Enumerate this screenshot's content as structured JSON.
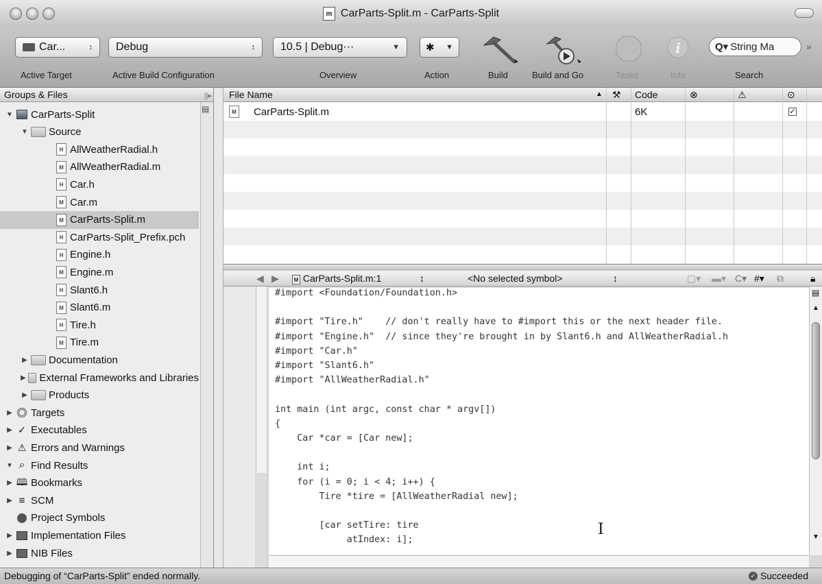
{
  "window": {
    "title": "CarParts-Split.m - CarParts-Split"
  },
  "toolbar": {
    "target_value": "Car...",
    "config_value": "Debug",
    "overview_value": "10.5 | Debug···",
    "search_placeholder": "String Ma",
    "labels": {
      "active_target": "Active Target",
      "active_build_configuration": "Active Build Configuration",
      "overview": "Overview",
      "action": "Action",
      "build": "Build",
      "build_and_go": "Build and Go",
      "tasks": "Tasks",
      "info": "Info",
      "search": "Search"
    }
  },
  "sidebar": {
    "header": "Groups & Files",
    "items": [
      {
        "label": "CarParts-Split",
        "tri": "▼",
        "type": "project",
        "indent": 0
      },
      {
        "label": "Source",
        "tri": "▼",
        "type": "folder",
        "indent": 1
      },
      {
        "label": "AllWeatherRadial.h",
        "type": "h",
        "indent": 2
      },
      {
        "label": "AllWeatherRadial.m",
        "type": "m",
        "indent": 2
      },
      {
        "label": "Car.h",
        "type": "h",
        "indent": 2
      },
      {
        "label": "Car.m",
        "type": "m",
        "indent": 2
      },
      {
        "label": "CarParts-Split.m",
        "type": "m",
        "indent": 2,
        "selected": true
      },
      {
        "label": "CarParts-Split_Prefix.pch",
        "type": "h",
        "indent": 2
      },
      {
        "label": "Engine.h",
        "type": "h",
        "indent": 2
      },
      {
        "label": "Engine.m",
        "type": "m",
        "indent": 2
      },
      {
        "label": "Slant6.h",
        "type": "h",
        "indent": 2
      },
      {
        "label": "Slant6.m",
        "type": "m",
        "indent": 2
      },
      {
        "label": "Tire.h",
        "type": "h",
        "indent": 2
      },
      {
        "label": "Tire.m",
        "type": "m",
        "indent": 2
      },
      {
        "label": "Documentation",
        "tri": "▶",
        "type": "folder",
        "indent": 1
      },
      {
        "label": "External Frameworks and Libraries",
        "tri": "▶",
        "type": "folder",
        "indent": 1
      },
      {
        "label": "Products",
        "tri": "▶",
        "type": "folder",
        "indent": 1
      },
      {
        "label": "Targets",
        "tri": "▶",
        "type": "targets",
        "indent": 0
      },
      {
        "label": "Executables",
        "tri": "▶",
        "type": "executables",
        "indent": 0
      },
      {
        "label": "Errors and Warnings",
        "tri": "▶",
        "type": "warnings",
        "indent": 0
      },
      {
        "label": "Find Results",
        "tri": "▼",
        "type": "find",
        "indent": 0
      },
      {
        "label": "Bookmarks",
        "tri": "▶",
        "type": "bookmarks",
        "indent": 0
      },
      {
        "label": "SCM",
        "tri": "▶",
        "type": "scm",
        "indent": 0
      },
      {
        "label": "Project Symbols",
        "type": "symbols",
        "indent": 0
      },
      {
        "label": "Implementation Files",
        "tri": "▶",
        "type": "smartgroup",
        "indent": 0
      },
      {
        "label": "NIB Files",
        "tri": "▶",
        "type": "smartgroup",
        "indent": 0
      }
    ]
  },
  "file_list": {
    "columns": {
      "file_name": "File Name",
      "code": "Code"
    },
    "rows": [
      {
        "name": "CarParts-Split.m",
        "code": "6K",
        "checked": true
      }
    ]
  },
  "editor": {
    "file_popup": "CarParts-Split.m:1",
    "symbol_popup": "<No selected symbol>",
    "lines": [
      "#import <Foundation/Foundation.h>",
      "",
      "#import \"Tire.h\"    // don't really have to #import this or the next header file.",
      "#import \"Engine.h\"  // since they're brought in by Slant6.h and AllWeatherRadial.h",
      "#import \"Car.h\"",
      "#import \"Slant6.h\"",
      "#import \"AllWeatherRadial.h\"",
      "",
      "int main (int argc, const char * argv[])",
      "{",
      "    Car *car = [Car new];",
      "",
      "    int i;",
      "    for (i = 0; i < 4; i++) {",
      "        Tire *tire = [AllWeatherRadial new];",
      "",
      "        [car setTire: tire",
      "             atIndex: i];"
    ]
  },
  "status": {
    "message": "Debugging of “CarParts-Split” ended normally.",
    "result": "Succeeded"
  }
}
